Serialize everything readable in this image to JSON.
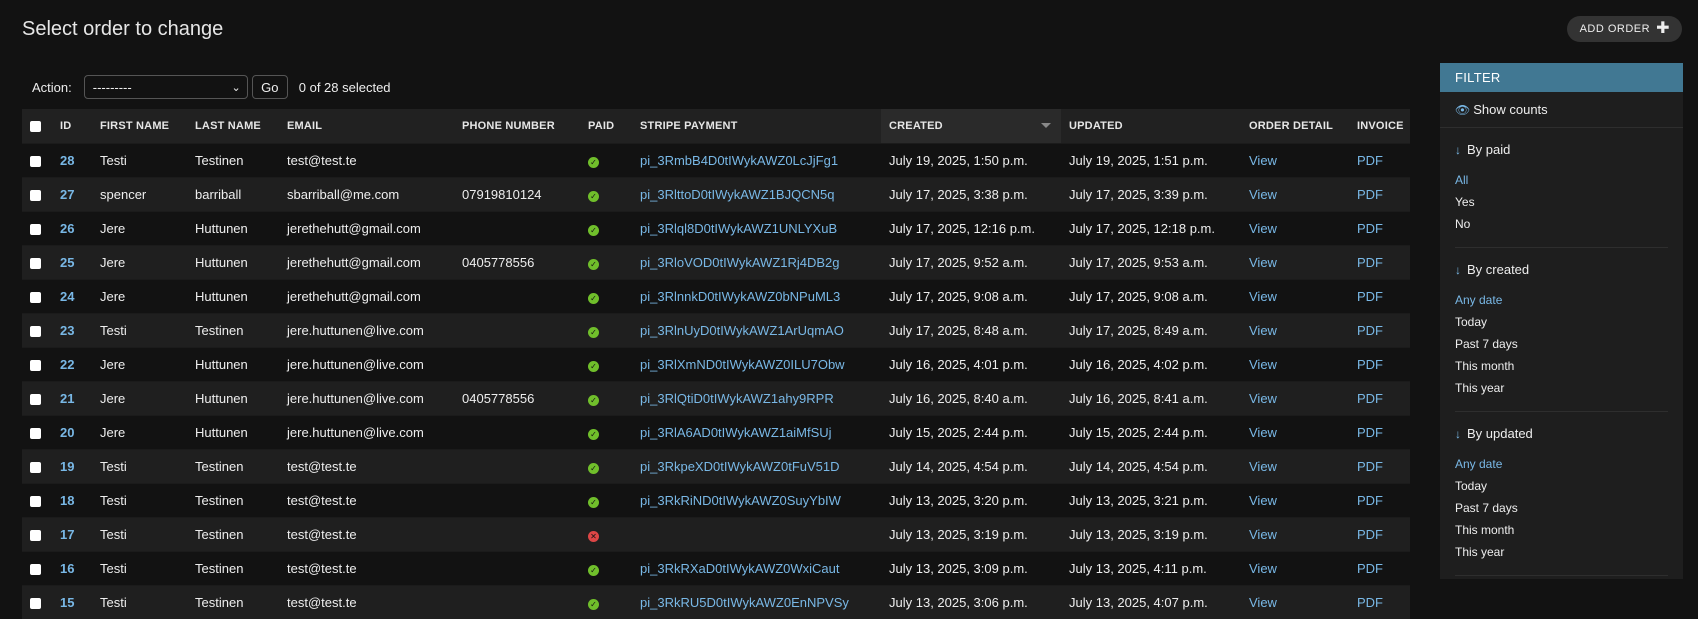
{
  "header": {
    "title": "Select order to change",
    "add_label": "ADD ORDER"
  },
  "actions": {
    "label": "Action:",
    "select_value": "---------",
    "go_label": "Go",
    "counter": "0 of 28 selected"
  },
  "table": {
    "columns": [
      "ID",
      "FIRST NAME",
      "LAST NAME",
      "EMAIL",
      "PHONE NUMBER",
      "PAID",
      "STRIPE PAYMENT",
      "CREATED",
      "UPDATED",
      "ORDER DETAIL",
      "INVOICE"
    ],
    "rows": [
      {
        "id": "28",
        "first": "Testi",
        "last": "Testinen",
        "email": "test@test.te",
        "phone": "",
        "paid": true,
        "stripe": "pi_3RmbB4D0tIWykAWZ0LcJjFg1",
        "created": "July 19, 2025, 1:50 p.m.",
        "updated": "July 19, 2025, 1:51 p.m.",
        "detail": "View",
        "invoice": "PDF"
      },
      {
        "id": "27",
        "first": "spencer",
        "last": "barriball",
        "email": "sbarriball@me.com",
        "phone": "07919810124",
        "paid": true,
        "stripe": "pi_3RlttoD0tIWykAWZ1BJQCN5q",
        "created": "July 17, 2025, 3:38 p.m.",
        "updated": "July 17, 2025, 3:39 p.m.",
        "detail": "View",
        "invoice": "PDF"
      },
      {
        "id": "26",
        "first": "Jere",
        "last": "Huttunen",
        "email": "jerethehutt@gmail.com",
        "phone": "",
        "paid": true,
        "stripe": "pi_3Rlql8D0tIWykAWZ1UNLYXuB",
        "created": "July 17, 2025, 12:16 p.m.",
        "updated": "July 17, 2025, 12:18 p.m.",
        "detail": "View",
        "invoice": "PDF"
      },
      {
        "id": "25",
        "first": "Jere",
        "last": "Huttunen",
        "email": "jerethehutt@gmail.com",
        "phone": "0405778556",
        "paid": true,
        "stripe": "pi_3RloVOD0tIWykAWZ1Rj4DB2g",
        "created": "July 17, 2025, 9:52 a.m.",
        "updated": "July 17, 2025, 9:53 a.m.",
        "detail": "View",
        "invoice": "PDF"
      },
      {
        "id": "24",
        "first": "Jere",
        "last": "Huttunen",
        "email": "jerethehutt@gmail.com",
        "phone": "",
        "paid": true,
        "stripe": "pi_3RlnnkD0tIWykAWZ0bNPuML3",
        "created": "July 17, 2025, 9:08 a.m.",
        "updated": "July 17, 2025, 9:08 a.m.",
        "detail": "View",
        "invoice": "PDF"
      },
      {
        "id": "23",
        "first": "Testi",
        "last": "Testinen",
        "email": "jere.huttunen@live.com",
        "phone": "",
        "paid": true,
        "stripe": "pi_3RlnUyD0tIWykAWZ1ArUqmAO",
        "created": "July 17, 2025, 8:48 a.m.",
        "updated": "July 17, 2025, 8:49 a.m.",
        "detail": "View",
        "invoice": "PDF"
      },
      {
        "id": "22",
        "first": "Jere",
        "last": "Huttunen",
        "email": "jere.huttunen@live.com",
        "phone": "",
        "paid": true,
        "stripe": "pi_3RlXmND0tIWykAWZ0ILU7Obw",
        "created": "July 16, 2025, 4:01 p.m.",
        "updated": "July 16, 2025, 4:02 p.m.",
        "detail": "View",
        "invoice": "PDF"
      },
      {
        "id": "21",
        "first": "Jere",
        "last": "Huttunen",
        "email": "jere.huttunen@live.com",
        "phone": "0405778556",
        "paid": true,
        "stripe": "pi_3RlQtiD0tIWykAWZ1ahy9RPR",
        "created": "July 16, 2025, 8:40 a.m.",
        "updated": "July 16, 2025, 8:41 a.m.",
        "detail": "View",
        "invoice": "PDF"
      },
      {
        "id": "20",
        "first": "Jere",
        "last": "Huttunen",
        "email": "jere.huttunen@live.com",
        "phone": "",
        "paid": true,
        "stripe": "pi_3RlA6AD0tIWykAWZ1aiMfSUj",
        "created": "July 15, 2025, 2:44 p.m.",
        "updated": "July 15, 2025, 2:44 p.m.",
        "detail": "View",
        "invoice": "PDF"
      },
      {
        "id": "19",
        "first": "Testi",
        "last": "Testinen",
        "email": "test@test.te",
        "phone": "",
        "paid": true,
        "stripe": "pi_3RkpeXD0tIWykAWZ0tFuV51D",
        "created": "July 14, 2025, 4:54 p.m.",
        "updated": "July 14, 2025, 4:54 p.m.",
        "detail": "View",
        "invoice": "PDF"
      },
      {
        "id": "18",
        "first": "Testi",
        "last": "Testinen",
        "email": "test@test.te",
        "phone": "",
        "paid": true,
        "stripe": "pi_3RkRiND0tIWykAWZ0SuyYbIW",
        "created": "July 13, 2025, 3:20 p.m.",
        "updated": "July 13, 2025, 3:21 p.m.",
        "detail": "View",
        "invoice": "PDF"
      },
      {
        "id": "17",
        "first": "Testi",
        "last": "Testinen",
        "email": "test@test.te",
        "phone": "",
        "paid": false,
        "stripe": "",
        "created": "July 13, 2025, 3:19 p.m.",
        "updated": "July 13, 2025, 3:19 p.m.",
        "detail": "View",
        "invoice": "PDF"
      },
      {
        "id": "16",
        "first": "Testi",
        "last": "Testinen",
        "email": "test@test.te",
        "phone": "",
        "paid": true,
        "stripe": "pi_3RkRXaD0tIWykAWZ0WxiCaut",
        "created": "July 13, 2025, 3:09 p.m.",
        "updated": "July 13, 2025, 4:11 p.m.",
        "detail": "View",
        "invoice": "PDF"
      },
      {
        "id": "15",
        "first": "Testi",
        "last": "Testinen",
        "email": "test@test.te",
        "phone": "",
        "paid": true,
        "stripe": "pi_3RkRU5D0tIWykAWZ0EnNPVSy",
        "created": "July 13, 2025, 3:06 p.m.",
        "updated": "July 13, 2025, 4:07 p.m.",
        "detail": "View",
        "invoice": "PDF"
      }
    ]
  },
  "filter": {
    "title": "FILTER",
    "show_counts": "Show counts",
    "groups": [
      {
        "title": "By paid",
        "options": [
          "All",
          "Yes",
          "No"
        ],
        "selected": "All"
      },
      {
        "title": "By created",
        "options": [
          "Any date",
          "Today",
          "Past 7 days",
          "This month",
          "This year"
        ],
        "selected": "Any date"
      },
      {
        "title": "By updated",
        "options": [
          "Any date",
          "Today",
          "Past 7 days",
          "This month",
          "This year"
        ],
        "selected": "Any date"
      }
    ]
  },
  "colors": {
    "background": "#121212",
    "accent_link": "#79b8e6",
    "filter_header": "#417893",
    "paid_yes": "#70bf2b",
    "paid_no": "#dd4646"
  },
  "icons": {
    "add": "plus-icon",
    "show_counts": "eye-icon",
    "filter_group": "arrow-down-icon",
    "paid_yes": "check-circle-icon",
    "paid_no": "x-circle-icon"
  }
}
